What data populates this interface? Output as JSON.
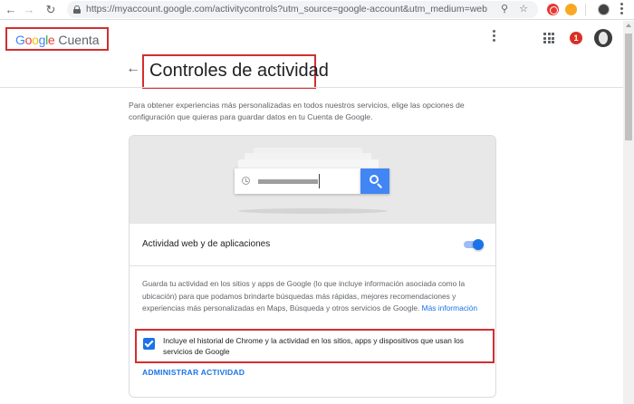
{
  "browser": {
    "url_host": "https://myaccount.google.com",
    "url_path": "/activitycontrols?utm_source=google-account&utm_medium=web",
    "icons": [
      "back-arrow-icon",
      "forward-arrow-icon",
      "reload-icon",
      "lock-icon",
      "zoom-icon",
      "star-icon",
      "extension-icon",
      "extension-icon",
      "profile-icon",
      "more-icon"
    ]
  },
  "appbar": {
    "brand_google": "Google",
    "brand_product": "Cuenta",
    "notification_count": "1",
    "google_colors": [
      "#4285f4",
      "#ea4335",
      "#fbbc05",
      "#4285f4",
      "#34a853",
      "#ea4335"
    ]
  },
  "page": {
    "title": "Controles de actividad",
    "intro": "Para obtener experiencias más personalizadas en todos nuestros servicios, elige las opciones de configuración que quieras para guardar datos en tu Cuenta de Google."
  },
  "card": {
    "setting_title": "Actividad web y de aplicaciones",
    "toggle_on": true,
    "description": "Guarda tu actividad en los sitios y apps de Google (lo que incluye información asociada como la ubicación) para que podamos brindarte búsquedas más rápidas, mejores recomendaciones y experiencias más personalizadas en Maps, Búsqueda y otros servicios de Google.",
    "more_info_link": "Más información",
    "checkbox_checked": true,
    "checkbox_label": "Incluye el historial de Chrome y la actividad en los sitios, apps y dispositivos que usan los servicios de Google",
    "manage_link": "ADMINISTRAR ACTIVIDAD"
  },
  "colors": {
    "accent": "#1a73e8",
    "highlight_border": "#d32f2f",
    "search_button": "#4285f4"
  }
}
